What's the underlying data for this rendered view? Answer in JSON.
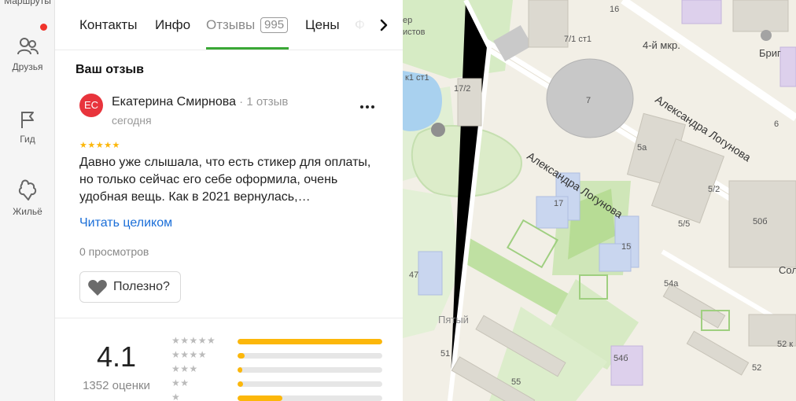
{
  "rail": {
    "routes_label": "Маршруты",
    "friends_label": "Друзья",
    "guide_label": "Гид",
    "housing_label": "Жильё"
  },
  "tabs": {
    "contacts": "Контакты",
    "info": "Инфо",
    "reviews": "Отзывы",
    "reviews_count": "995",
    "prices": "Цены",
    "photos_partial": "Ф"
  },
  "review": {
    "section_title": "Ваш отзыв",
    "avatar_initials": "ЕС",
    "author_name": "Екатерина Смирнова",
    "author_meta": " · 1 отзыв",
    "date": "сегодня",
    "stars": "★★★★★",
    "text": "Давно уже слышала, что есть стикер для оплаты, но только сейчас его себе оформила, очень удобная вещь. Как в 2021 вернулась,…",
    "read_more": "Читать целиком",
    "views": "0 просмотров",
    "useful_label": "Полезно?"
  },
  "summary": {
    "rating": "4.1",
    "count": "1352 оценки",
    "distribution": [
      {
        "stars": "★★★★★",
        "fraction": 1.0
      },
      {
        "stars": "★★★★",
        "fraction": 0.05
      },
      {
        "stars": "★★★",
        "fraction": 0.03
      },
      {
        "stars": "★★",
        "fraction": 0.04
      },
      {
        "stars": "★",
        "fraction": 0.31
      }
    ]
  },
  "map": {
    "labels": {
      "l16": "16",
      "mkr4": "4-й мкр.",
      "brig": "Бриг",
      "l71": "7/1 ст1",
      "l7": "7",
      "street1": "Александра Логунова",
      "street2": "Александра Логунова",
      "l172": "17/2",
      "k1": "к1 ст1",
      "istov": "истов",
      "er": "ер",
      "l5a": "5а",
      "l52": "5/2",
      "l6": "6",
      "l17": "17",
      "l15": "15",
      "l55": "5/5",
      "l50b": "50б",
      "sol": "Сол",
      "l54a": "54а",
      "l47": "47",
      "pyatiy": "Пятый",
      "l51": "51",
      "l54b": "54б",
      "l55b": "55",
      "l52k": "52 к",
      "l52b": "52"
    }
  },
  "colors": {
    "accent_green": "#3aa836",
    "star_yellow": "#fcb70a",
    "link_blue": "#1a6ed8",
    "avatar_red": "#e8343c",
    "notif_red": "#f0332b"
  }
}
